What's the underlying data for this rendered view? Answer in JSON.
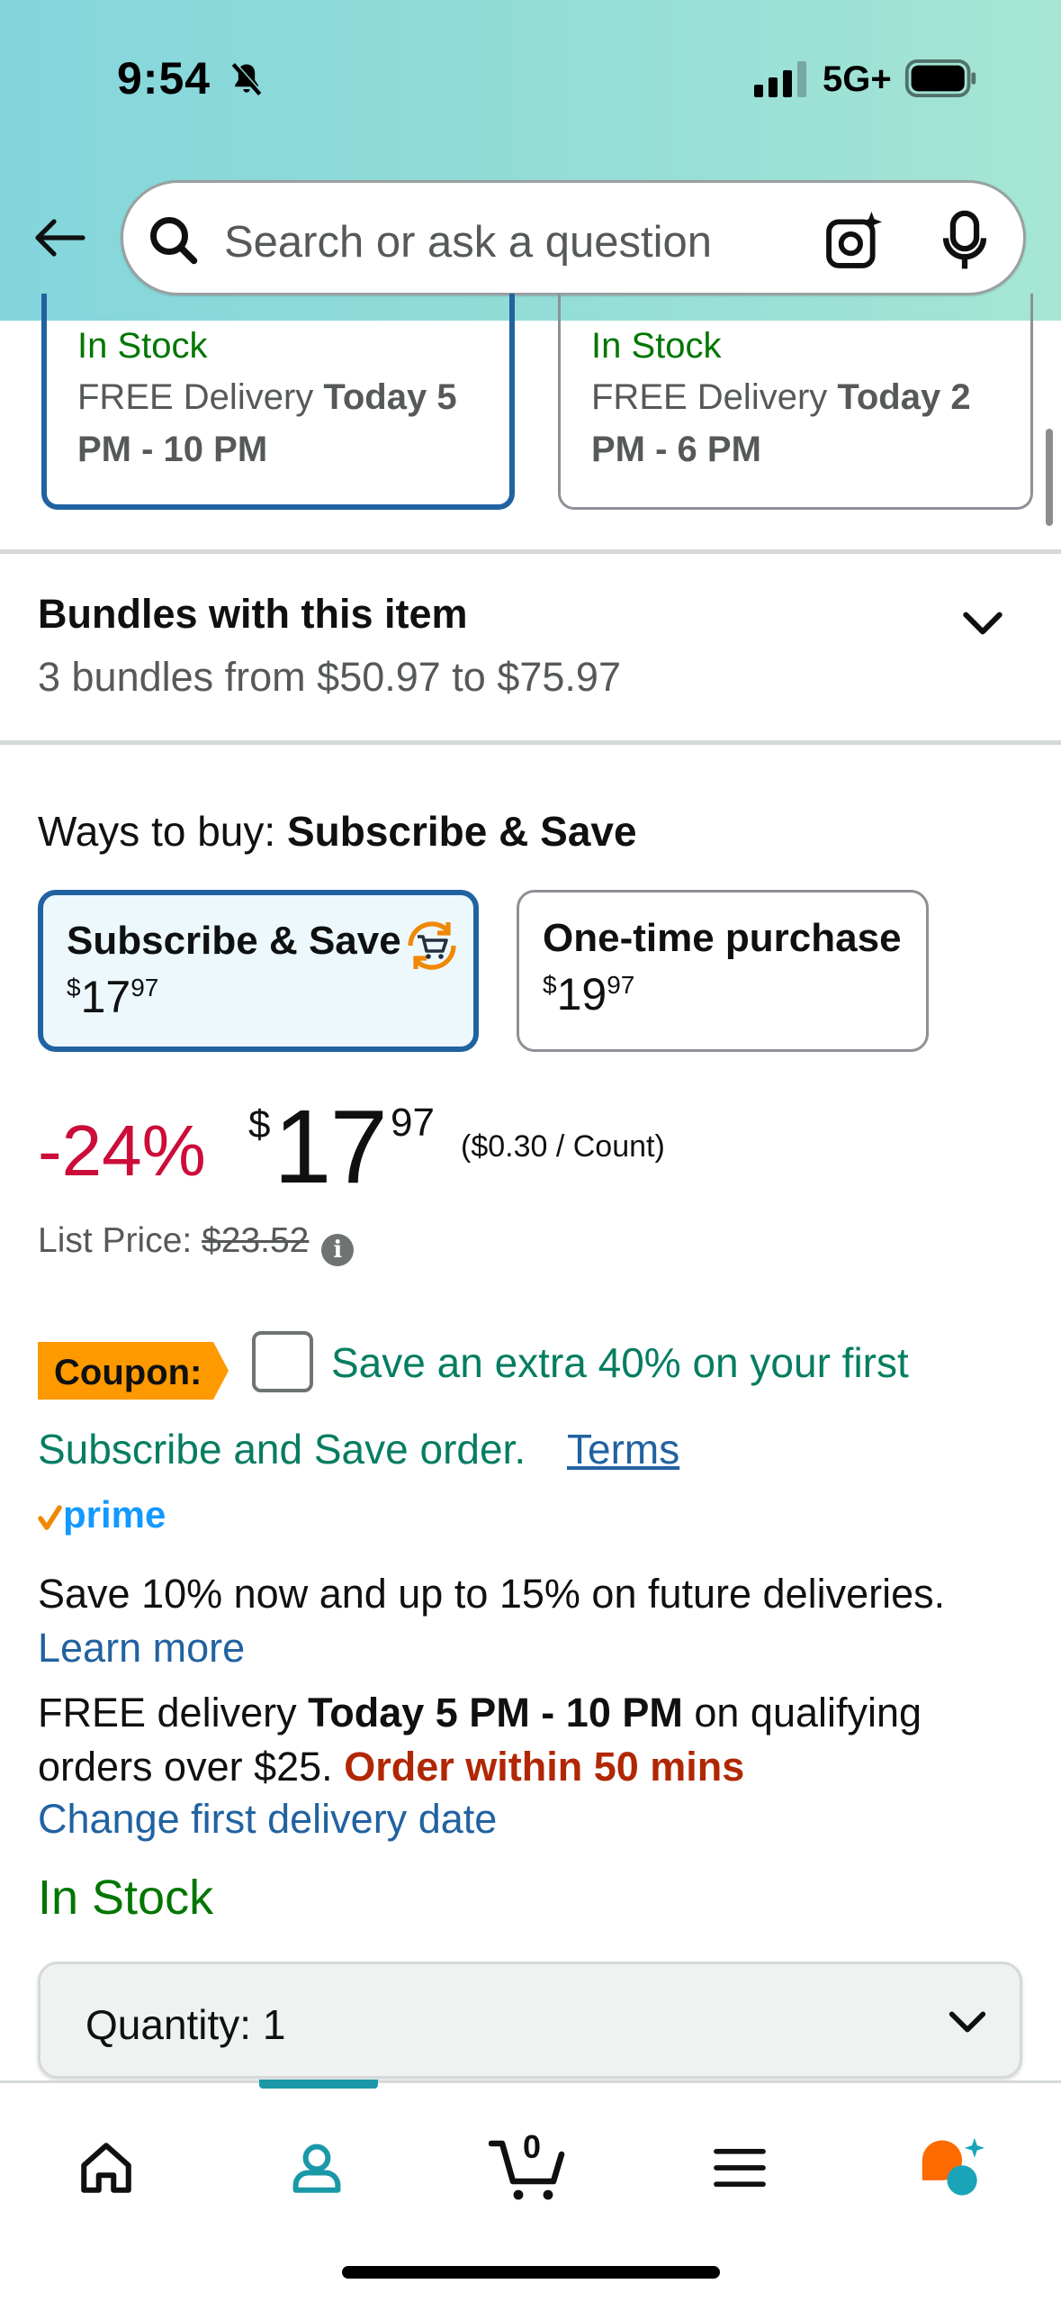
{
  "status_bar": {
    "time": "9:54",
    "network": "5G+"
  },
  "search": {
    "placeholder": "Search or ask a question"
  },
  "delivery_options": [
    {
      "stock": "In Stock",
      "prefix": "FREE Delivery ",
      "window": "Today 5 PM - 10 PM",
      "selected": true
    },
    {
      "stock": "In Stock",
      "prefix": "FREE Delivery ",
      "window": "Today 2 PM - 6 PM",
      "selected": false
    }
  ],
  "bundles": {
    "title": "Bundles with this item",
    "subtitle": "3 bundles from $50.97 to $75.97"
  },
  "ways_to_buy": {
    "label": "Ways to buy: ",
    "selected": "Subscribe & Save",
    "options": [
      {
        "label": "Subscribe & Save",
        "currency": "$",
        "whole": "17",
        "cents": "97"
      },
      {
        "label": "One-time purchase",
        "currency": "$",
        "whole": "19",
        "cents": "97"
      }
    ]
  },
  "price": {
    "discount": "-24%",
    "currency": "$",
    "whole": "17",
    "cents": "97",
    "unit": "($0.30 / Count)",
    "list_label": "List Price: ",
    "list_value": "$23.52"
  },
  "coupon": {
    "badge": "Coupon:",
    "text_line1": "Save an extra 40% on your first",
    "text_line2": "Subscribe and Save order.",
    "terms": "Terms"
  },
  "prime": {
    "logo_text": "prime"
  },
  "subscribe_info": {
    "text": "Save 10% now and up to 15% on future deliveries. ",
    "learn_more": "Learn more"
  },
  "delivery_info": {
    "prefix": "FREE delivery ",
    "window": "Today 5 PM - 10 PM",
    "suffix": " on qualifying orders over $25. ",
    "urgency": "Order within 50 mins",
    "change_link": "Change first delivery date"
  },
  "stock_status": "In Stock",
  "quantity": {
    "label": "Quantity: ",
    "value": "1"
  },
  "tabbar": {
    "cart_count": "0",
    "active_tab": "account"
  },
  "colors": {
    "accent_blue": "#2162a1",
    "teal_indicator": "#1a98a8",
    "discount_red": "#cc0c39",
    "stock_green": "#007600",
    "coupon_green": "#067d62",
    "coupon_orange": "#ff9900",
    "urgency_red": "#b12704"
  }
}
